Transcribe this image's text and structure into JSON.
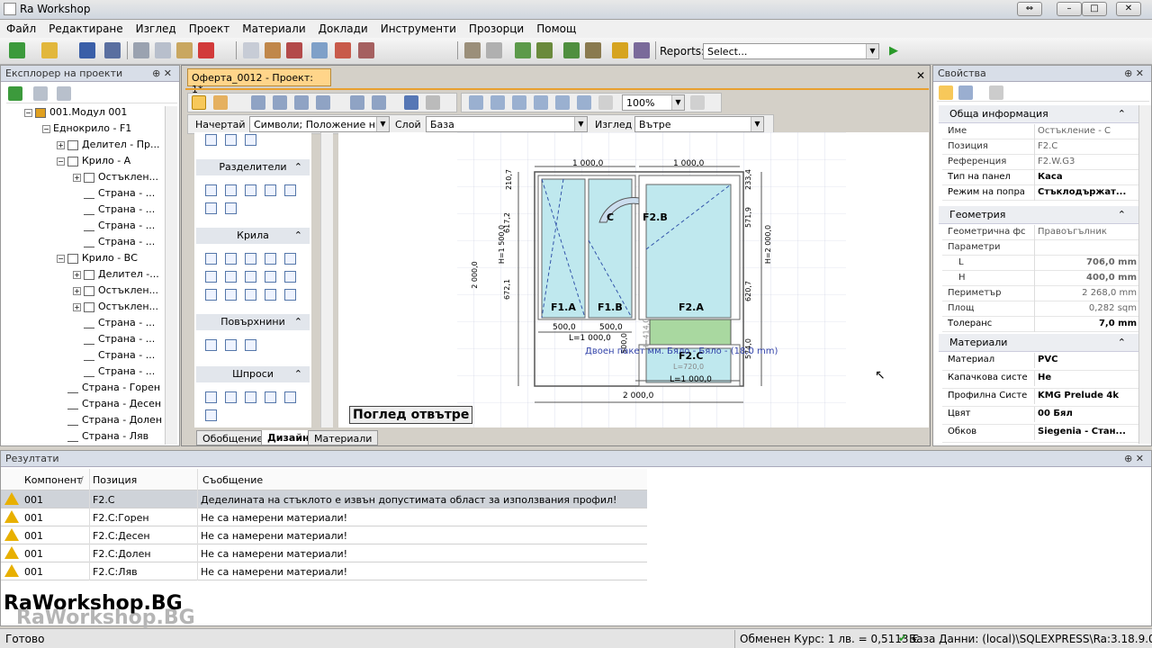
{
  "window": {
    "title": "Ra Workshop"
  },
  "menu": [
    "Файл",
    "Редактиране",
    "Изглед",
    "Проект",
    "Материали",
    "Доклади",
    "Инструменти",
    "Прозорци",
    "Помощ"
  ],
  "toolbar": {
    "reports_label": "Reports:",
    "reports_value": "Select..."
  },
  "explorer": {
    "title": "Експлорер на проекти",
    "items": [
      "001.Модул 001",
      "Еднокрило - F1",
      "Делител - Пр...",
      "Крило - А",
      "Остъклен...",
      "Страна - ...",
      "Страна - ...",
      "Страна - ...",
      "Страна - ...",
      "Крило - ВС",
      "Делител -...",
      "Остъклен...",
      "Остъклен...",
      "Страна - ...",
      "Страна - ...",
      "Страна - ...",
      "Страна - ...",
      "Страна - Горен",
      "Страна - Десен",
      "Страна - Долен",
      "Страна - Ляв"
    ]
  },
  "document": {
    "tab_title": "Оферта_0012 - Проект: 1*",
    "zoom": "100%",
    "draw_label": "Начертай",
    "draw_value": "Символи; Положение н...",
    "layer_label": "Слой",
    "layer_value": "База",
    "view_label": "Изглед",
    "view_value": "Вътре",
    "palette": {
      "groups": [
        "Разделители",
        "Крила",
        "Повърхнини",
        "Шпроси"
      ]
    },
    "view_caption": "Поглед отвътре",
    "bottom_tabs": [
      "Обобщение",
      "Дизайн",
      "Материали"
    ],
    "drawing": {
      "dims_top": [
        "1 000,0",
        "1 000,0"
      ],
      "dims_bottom": [
        "500,0",
        "500,0",
        "L=1 000,0",
        "L=720,0",
        "L=1 000,0",
        "2 000,0"
      ],
      "dims_left": [
        "210,7",
        "617,2",
        "H=1 500,0",
        "2 000,0",
        "672,1",
        "500,0",
        "H=414,0"
      ],
      "dims_right": [
        "233,4",
        "571,9",
        "H=2 000,0",
        "620,7",
        "574,0"
      ],
      "labels": [
        "F1.A",
        "F1.B",
        "F2.A",
        "F2.B",
        "F2.C",
        "C"
      ],
      "glass_note": "Двоен пакет мм. Бяло - Бяло - (18,0 mm)"
    }
  },
  "properties": {
    "title": "Свойства",
    "sections": [
      {
        "name": "Обща информация",
        "rows": [
          [
            "Име",
            "Остъкление - С"
          ],
          [
            "Позиция",
            "F2.C"
          ],
          [
            "Референция",
            "F2.W.G3"
          ],
          [
            "Тип на панел",
            "Каса"
          ],
          [
            "Режим на попра",
            "Стъклодържат..."
          ]
        ]
      },
      {
        "name": "Геометрия",
        "rows": [
          [
            "Геометрична фс",
            "Правоъгълник"
          ],
          [
            "Параметри",
            ""
          ],
          [
            "L",
            "706,0 mm"
          ],
          [
            "H",
            "400,0 mm"
          ],
          [
            "Периметър",
            "2 268,0 mm"
          ],
          [
            "Площ",
            "0,282 sqm"
          ],
          [
            "Толеранс",
            "7,0 mm"
          ]
        ]
      },
      {
        "name": "Материали",
        "rows": [
          [
            "Материал",
            "PVC"
          ],
          [
            "Капачкова систе",
            "Не"
          ],
          [
            "Профилна Систе",
            "KMG Prelude 4k"
          ],
          [
            "Цвят",
            "00 Бял"
          ],
          [
            "Обков",
            "Siegenia - Стан..."
          ]
        ]
      }
    ]
  },
  "results": {
    "title": "Резултати",
    "columns": [
      "Компонент",
      "Позиция",
      "Съобщение"
    ],
    "rows": [
      [
        "001",
        "F2.C",
        "Деделината на стъклото е извън допустимата област за използвания профил!"
      ],
      [
        "001",
        "F2.C:Горен",
        "Не са намерени материали!"
      ],
      [
        "001",
        "F2.C:Десен",
        "Не са намерени материали!"
      ],
      [
        "001",
        "F2.C:Долен",
        "Не са намерени материали!"
      ],
      [
        "001",
        "F2.C:Ляв",
        "Не са намерени материали!"
      ]
    ]
  },
  "watermark": "RaWorkshop.BG",
  "status": {
    "left": "Готово",
    "rate": "Обменен Курс: 1 лв. = 0,5113 €",
    "db": "База Данни: (local)\\SQLEXPRESS\\Ra:3.18.9.0-1-1.0"
  }
}
